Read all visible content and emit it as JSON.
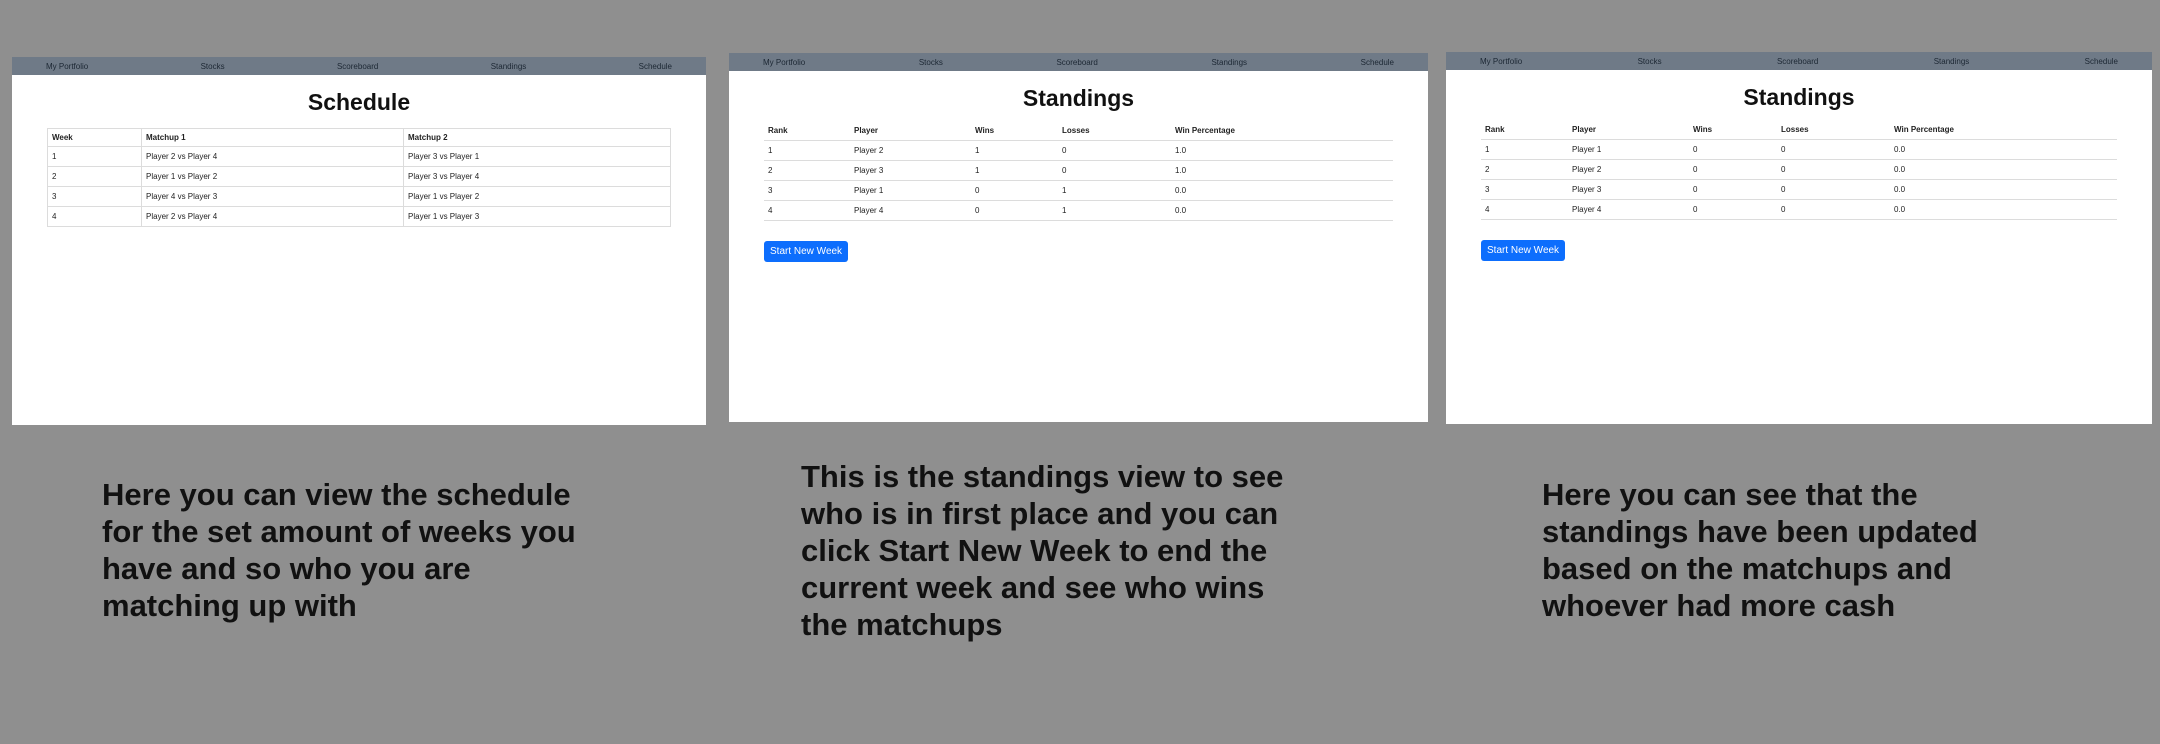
{
  "nav": [
    "My Portfolio",
    "Stocks",
    "Scoreboard",
    "Standings",
    "Schedule"
  ],
  "schedule_panel": {
    "title": "Schedule",
    "headers": [
      "Week",
      "Matchup 1",
      "Matchup 2"
    ],
    "rows": [
      [
        "1",
        "Player 2 vs Player 4",
        "Player 3 vs Player 1"
      ],
      [
        "2",
        "Player 1 vs Player 2",
        "Player 3 vs Player 4"
      ],
      [
        "3",
        "Player 4 vs Player 3",
        "Player 1 vs Player 2"
      ],
      [
        "4",
        "Player 2 vs Player 4",
        "Player 1 vs Player 3"
      ]
    ],
    "caption": "Here you can view the schedule\nfor the set amount of weeks you\nhave and so who you are\nmatching up with"
  },
  "standings_before": {
    "title": "Standings",
    "headers": [
      "Rank",
      "Player",
      "Wins",
      "Losses",
      "Win Percentage"
    ],
    "rows": [
      [
        "1",
        "Player 2",
        "1",
        "0",
        "1.0"
      ],
      [
        "2",
        "Player 3",
        "1",
        "0",
        "1.0"
      ],
      [
        "3",
        "Player 1",
        "0",
        "1",
        "0.0"
      ],
      [
        "4",
        "Player 4",
        "0",
        "1",
        "0.0"
      ]
    ],
    "button": "Start New Week",
    "caption": "This is the standings view to see\nwho is in first place and you can\nclick Start New Week to end the\ncurrent week and see who wins\nthe matchups"
  },
  "standings_after": {
    "title": "Standings",
    "headers": [
      "Rank",
      "Player",
      "Wins",
      "Losses",
      "Win Percentage"
    ],
    "rows": [
      [
        "1",
        "Player 1",
        "0",
        "0",
        "0.0"
      ],
      [
        "2",
        "Player 2",
        "0",
        "0",
        "0.0"
      ],
      [
        "3",
        "Player 3",
        "0",
        "0",
        "0.0"
      ],
      [
        "4",
        "Player 4",
        "0",
        "0",
        "0.0"
      ]
    ],
    "button": "Start New Week",
    "caption": "Here you can see that the\nstandings have been updated\nbased on the matchups and\nwhoever had more cash"
  },
  "colors": {
    "background": "#8f8f8f",
    "navbar": "#6f7a87",
    "button": "#0d6efd"
  }
}
